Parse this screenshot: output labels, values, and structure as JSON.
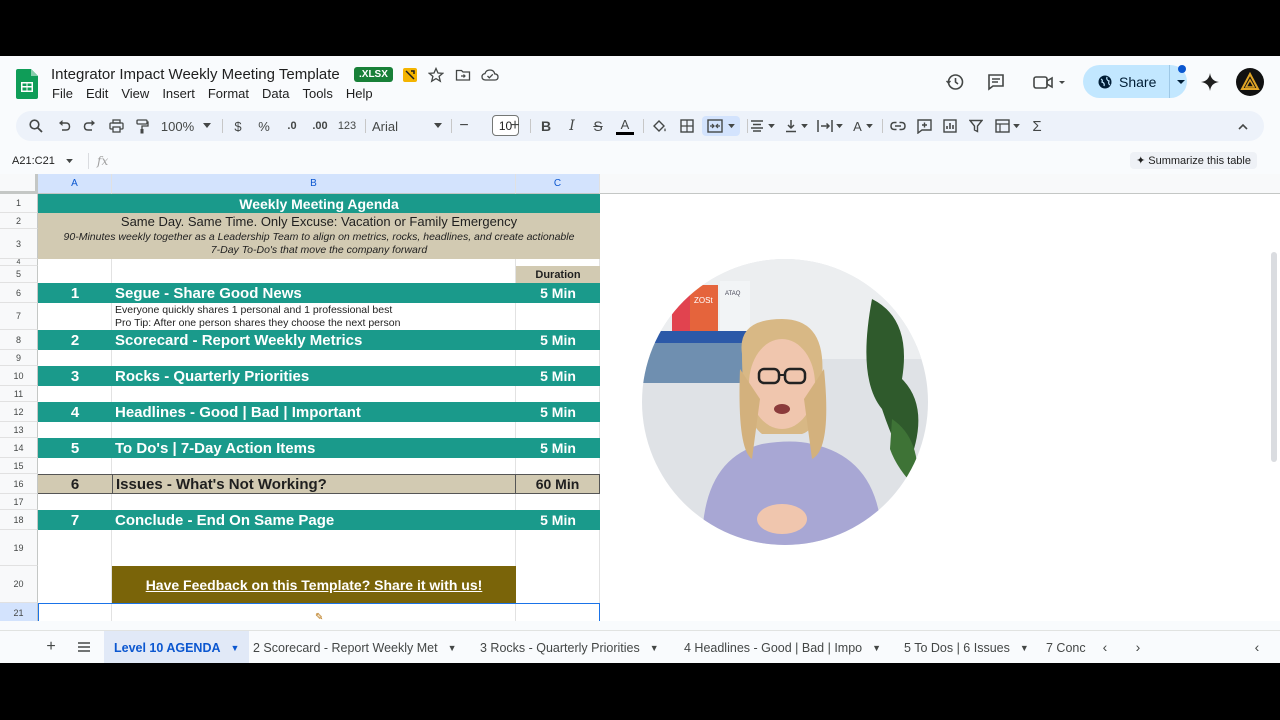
{
  "document": {
    "title": "Integrator Impact Weekly Meeting Template",
    "format_badge": ".XLSX"
  },
  "menu": [
    "File",
    "Edit",
    "View",
    "Insert",
    "Format",
    "Data",
    "Tools",
    "Help"
  ],
  "header": {
    "share_label": "Share"
  },
  "toolbar": {
    "zoom": "100%",
    "currency": "$",
    "percent": "%",
    "decrease_decimal": ".0",
    "increase_decimal": ".00",
    "number_format": "123",
    "font": "Arial",
    "font_size": "10"
  },
  "formula_bar": {
    "name_box": "A21:C21",
    "fx": "fx",
    "summarize_label": "Summarize this table"
  },
  "columns": [
    "A",
    "B",
    "C"
  ],
  "rows": [
    "1",
    "2",
    "3",
    "4",
    "5",
    "6",
    "7",
    "8",
    "9",
    "10",
    "11",
    "12",
    "13",
    "14",
    "15",
    "16",
    "17",
    "18",
    "19",
    "20",
    "21"
  ],
  "sheet": {
    "title": "Weekly Meeting Agenda",
    "subtitle": "Same Day. Same Time. Only Excuse: Vacation or Family Emergency",
    "description_line1": "90-Minutes weekly together as a Leadership Team to align on metrics, rocks, headlines, and create actionable",
    "description_line2": "7-Day To-Do's that move the company forward",
    "duration_header": "Duration",
    "items": [
      {
        "num": "1",
        "topic": "Segue - Share Good News",
        "duration": "5 Min"
      },
      {
        "num": "2",
        "topic": "Scorecard - Report Weekly Metrics",
        "duration": "5 Min"
      },
      {
        "num": "3",
        "topic": "Rocks - Quarterly Priorities",
        "duration": "5 Min"
      },
      {
        "num": "4",
        "topic": "Headlines - Good | Bad | Important",
        "duration": "5 Min"
      },
      {
        "num": "5",
        "topic": "To Do's | 7-Day Action Items",
        "duration": "5 Min"
      },
      {
        "num": "6",
        "topic": "Issues - What's Not Working?",
        "duration": "60 Min"
      },
      {
        "num": "7",
        "topic": "Conclude - End On Same Page",
        "duration": "5 Min"
      }
    ],
    "segue_note_line1": "Everyone quickly shares 1 personal and 1 professional best",
    "segue_note_line2": "Pro Tip: After one person shares they choose the next person",
    "feedback_link": "Have Feedback on this Template?  Share it with us!"
  },
  "video": {
    "shelf_book1": "ZOSt",
    "shelf_book2": "ATAQ"
  },
  "tabs": [
    {
      "label": "Level 10 AGENDA",
      "active": true
    },
    {
      "label": "2 Scorecard - Report Weekly Met",
      "active": false
    },
    {
      "label": "3 Rocks - Quarterly Priorities",
      "active": false
    },
    {
      "label": "4 Headlines - Good | Bad | Impo",
      "active": false
    },
    {
      "label": "5 To Dos | 6 Issues",
      "active": false
    },
    {
      "label": "7 Conc",
      "active": false
    }
  ],
  "colors": {
    "teal": "#1a9a8b",
    "tan": "#d2cab2",
    "feedback_bg": "#7a6409",
    "share_bg": "#c2e7ff"
  }
}
